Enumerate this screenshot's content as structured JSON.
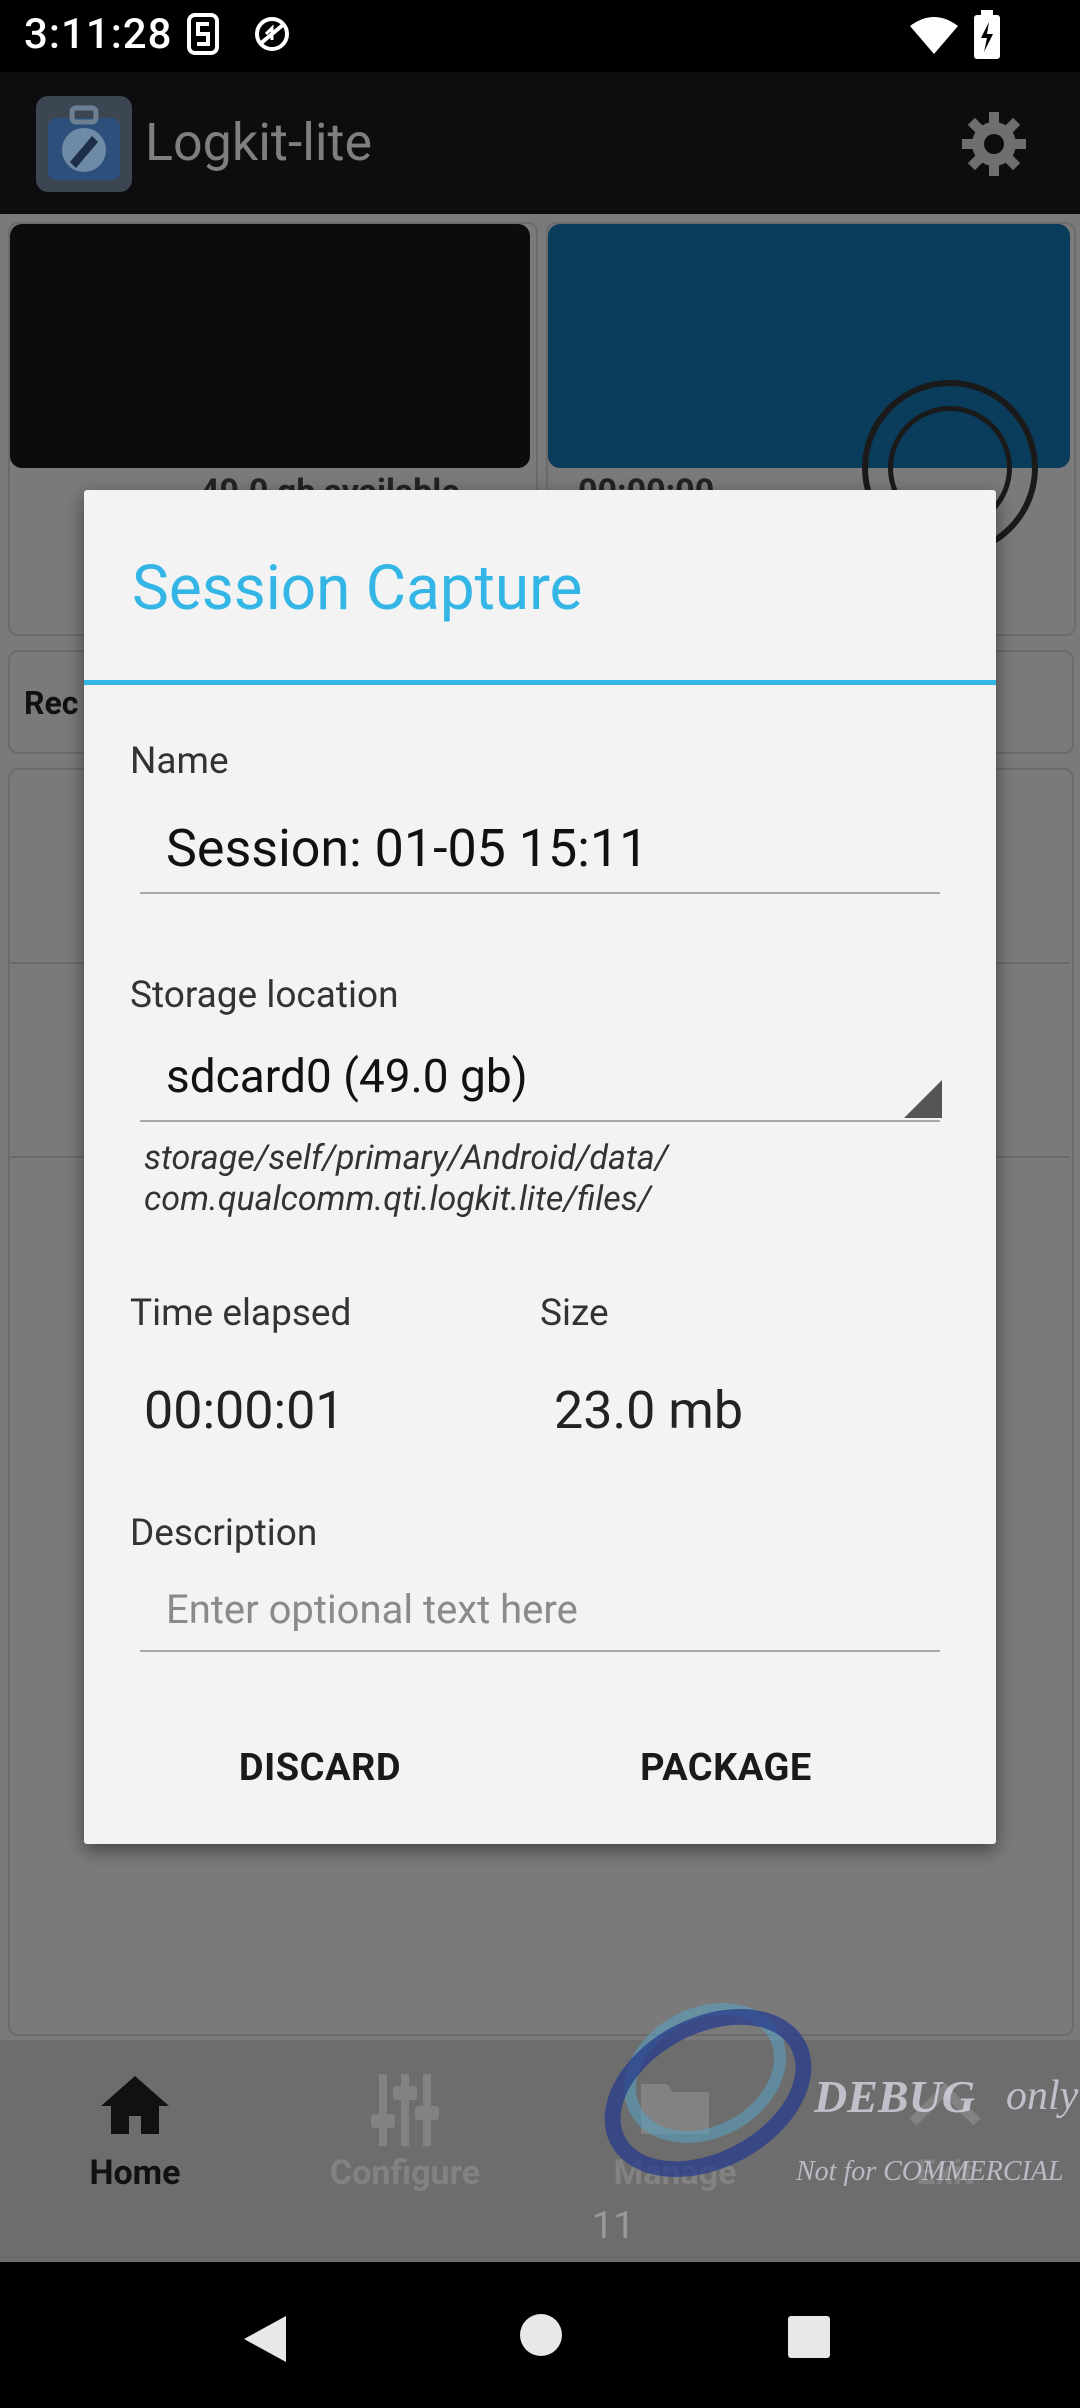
{
  "status_bar": {
    "time": "3:11:28",
    "icons": [
      "notification-s-icon",
      "no-sync-icon",
      "wifi-icon",
      "battery-charging-icon"
    ]
  },
  "app_bar": {
    "title": "Logkit-lite",
    "settings_icon": "gear-icon"
  },
  "background": {
    "storage_text": "49.0 gb available",
    "timer_text": "00:00:00",
    "section_label": "Rec"
  },
  "dialog": {
    "title": "Session Capture",
    "name_label": "Name",
    "name_value": "Session: 01-05 15:11",
    "storage_label": "Storage location",
    "storage_value": "sdcard0 (49.0 gb)",
    "path_line1": "storage/self/primary/Android/data/",
    "path_line2": "com.qualcomm.qti.logkit.lite/files/",
    "time_label": "Time elapsed",
    "time_value": "00:00:01",
    "size_label": "Size",
    "size_value": "23.0 mb",
    "description_label": "Description",
    "description_placeholder": "Enter optional text here",
    "discard_label": "DISCARD",
    "package_label": "PACKAGE"
  },
  "bottom_nav": {
    "items": [
      {
        "label": "Home",
        "icon": "home-icon",
        "active": true
      },
      {
        "label": "Configure",
        "icon": "sliders-icon",
        "active": false
      },
      {
        "label": "Manage",
        "icon": "folder-icon",
        "active": false
      },
      {
        "label": "Exit",
        "icon": "chevron-up-icon",
        "active": false
      }
    ]
  },
  "watermark": {
    "title": "DEBUG",
    "title_suffix": "only",
    "subtitle": "Not for COMMERCIAL"
  },
  "page_number": "11",
  "colors": {
    "accent": "#33b5e5",
    "dialog_bg": "#f3f3f3",
    "scrim": "#7a7a7a"
  }
}
